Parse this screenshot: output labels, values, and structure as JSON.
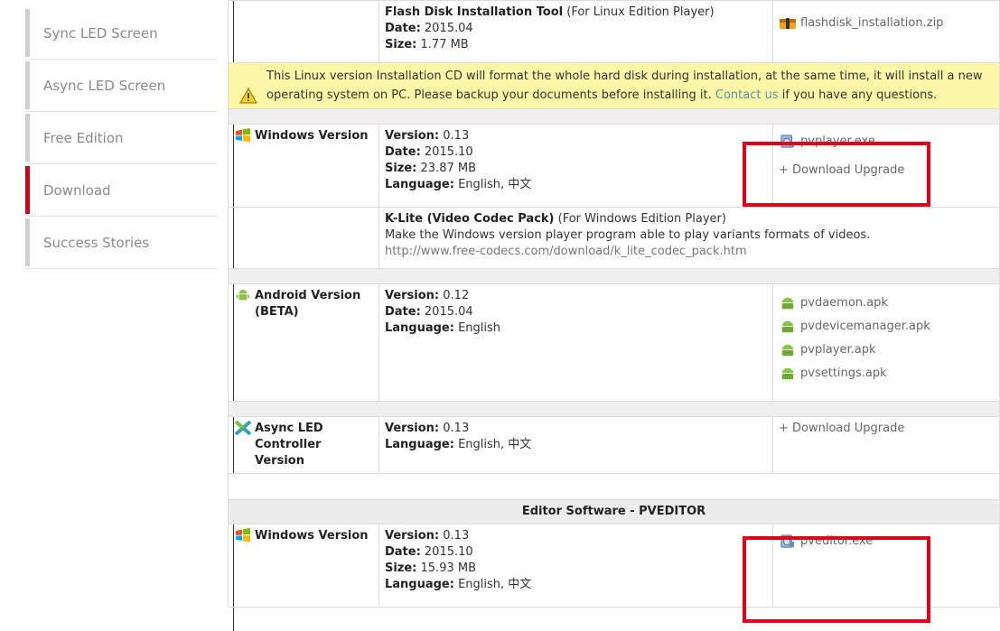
{
  "sidebar": {
    "items": [
      {
        "label": "Sync LED Screen"
      },
      {
        "label": "Async LED Screen"
      },
      {
        "label": "Free Edition"
      },
      {
        "label": "Download",
        "active": true
      },
      {
        "label": "Success Stories"
      }
    ]
  },
  "flashdisk": {
    "title": "Flash Disk Installation Tool",
    "note": "(For Linux Edition Player)",
    "date_label": "Date:",
    "date": "2015.04",
    "size_label": "Size:",
    "size": "1.77 MB",
    "file": "flashdisk_installation.zip"
  },
  "warning": {
    "text_before": "This Linux version Installation CD will format the whole hard disk during installation, at the same time, it will install a new operating system on PC. Please backup your documents before installing it.",
    "link": "Contact us",
    "text_after": "if you have any questions."
  },
  "windows_player": {
    "platform": "Windows Version",
    "version_label": "Version:",
    "version": "0.13",
    "date_label": "Date:",
    "date": "2015.10",
    "size_label": "Size:",
    "size": "23.87 MB",
    "language_label": "Language:",
    "language": "English, 中文",
    "file": "pvplayer.exe",
    "upgrade": "+ Download Upgrade"
  },
  "klite": {
    "title": "K-Lite (Video Codec Pack)",
    "note": "(For Windows Edition Player)",
    "desc": "Make the Windows version player program able to play variants formats of videos.",
    "url": "http://www.free-codecs.com/download/k_lite_codec_pack.htm"
  },
  "android": {
    "platform": "Android Version (BETA)",
    "version_label": "Version:",
    "version": "0.12",
    "date_label": "Date:",
    "date": "2015.04",
    "language_label": "Language:",
    "language": "English",
    "files": [
      "pvdaemon.apk",
      "pvdevicemanager.apk",
      "pvplayer.apk",
      "pvsettings.apk"
    ]
  },
  "async_ctrl": {
    "platform": "Async LED Controller Version",
    "version_label": "Version:",
    "version": "0.13",
    "language_label": "Language:",
    "language": "English, 中文",
    "upgrade": "+ Download Upgrade"
  },
  "editor": {
    "heading": "Editor Software - PVEDITOR",
    "platform": "Windows Version",
    "version_label": "Version:",
    "version": "0.13",
    "date_label": "Date:",
    "date": "2015.10",
    "size_label": "Size:",
    "size": "15.93 MB",
    "language_label": "Language:",
    "language": "English, 中文",
    "file": "pveditor.exe"
  },
  "colors": {
    "highlight": "#e0001a",
    "active": "#d0021b",
    "warning_bg": "#fbf7a7"
  }
}
